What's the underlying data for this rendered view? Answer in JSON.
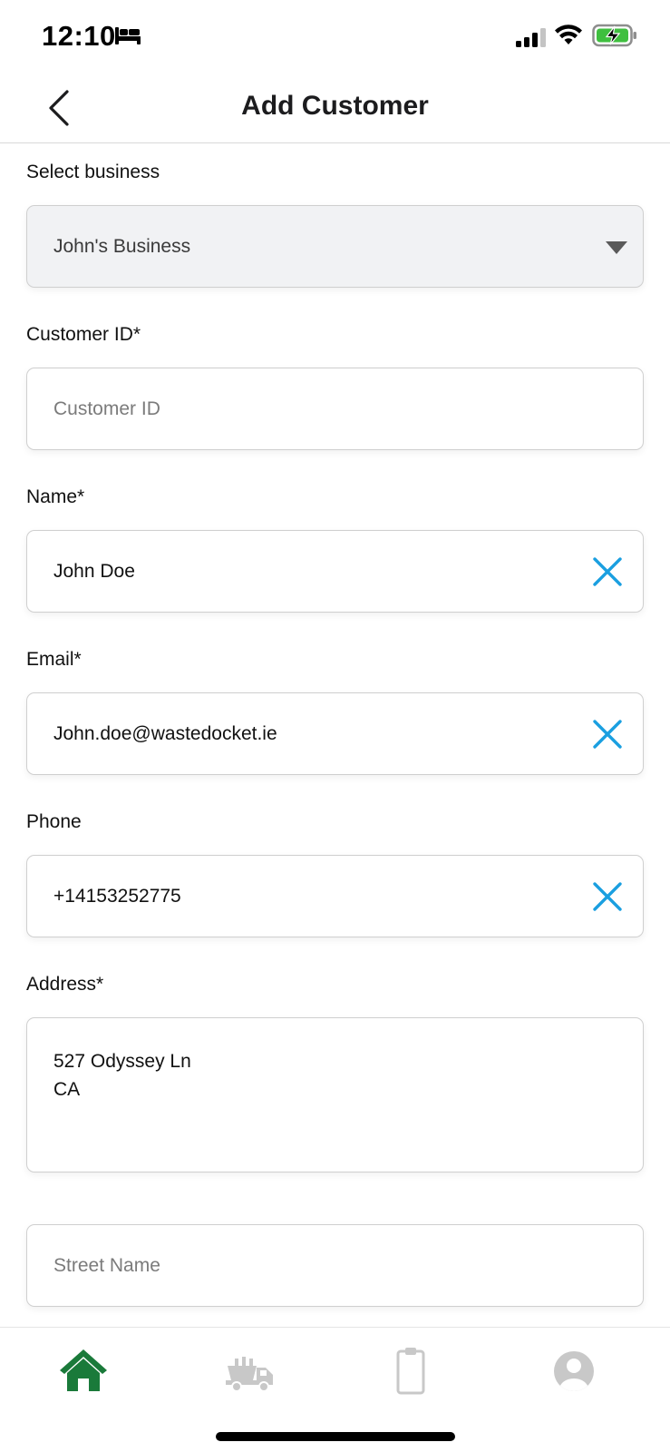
{
  "status_bar": {
    "time": "12:10",
    "icons": [
      "bed-icon",
      "signal-icon",
      "wifi-icon",
      "battery-charging-icon"
    ],
    "battery_color": "#3fbf3f"
  },
  "nav": {
    "title": "Add Customer",
    "back_icon": "chevron-left-icon"
  },
  "form": {
    "business": {
      "label": "Select business",
      "value": "John's Business",
      "icon": "caret-down-icon"
    },
    "customer_id": {
      "label": "Customer ID*",
      "value": "",
      "placeholder": "Customer ID"
    },
    "name": {
      "label": "Name*",
      "value": "John Doe"
    },
    "email": {
      "label": "Email*",
      "value": "John.doe@wastedocket.ie"
    },
    "phone": {
      "label": "Phone",
      "value": "+14153252775"
    },
    "address": {
      "label": "Address*",
      "value": "527 Odyssey Ln\nCA"
    },
    "street_name": {
      "value": "",
      "placeholder": "Street Name"
    },
    "clear_icon_color": "#1a9fe0"
  },
  "tab_bar": {
    "tabs": [
      {
        "icon": "home-icon",
        "active": true,
        "color": "#1a7a3a"
      },
      {
        "icon": "skip-truck-icon",
        "active": false,
        "color": "#c8c8c8"
      },
      {
        "icon": "clipboard-icon",
        "active": false,
        "color": "#c8c8c8"
      },
      {
        "icon": "profile-icon",
        "active": false,
        "color": "#c8c8c8"
      }
    ]
  }
}
